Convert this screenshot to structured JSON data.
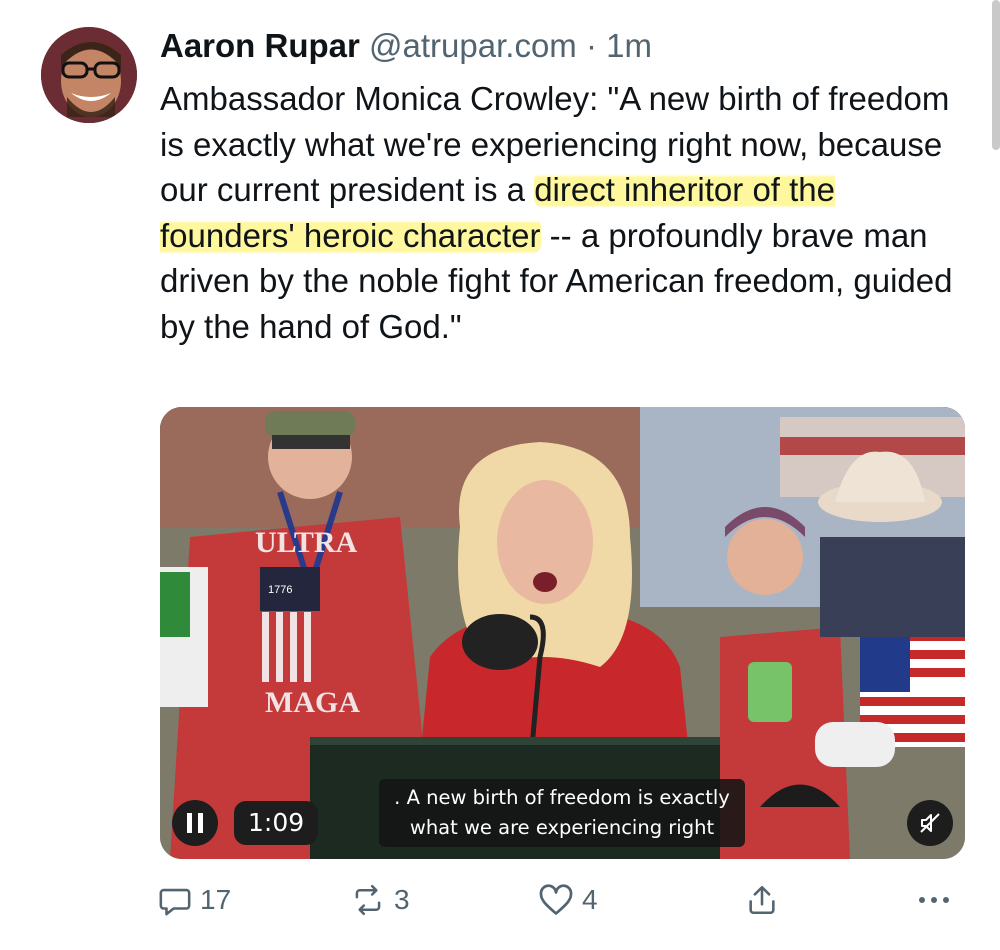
{
  "post": {
    "author": {
      "name": "Aaron Rupar",
      "handle": "@atrupar.com",
      "separator": "·",
      "time": "1m"
    },
    "text": {
      "part1": "Ambassador Monica Crowley: \"A new birth of freedom is exactly what we're experiencing right now, because our current president is a ",
      "highlight": "direct inheritor of the founders' heroic character",
      "part2": " -- a profoundly brave man driven by the noble fight for American freedom, guided by the hand of God.\""
    },
    "media": {
      "timestamp": "1:09",
      "caption_line1": ". A new birth of freedom is exactly",
      "caption_line2": "what we are experiencing right",
      "shirt_text_top": "ULTRA",
      "shirt_text_bottom": "MAGA",
      "shirt_year": "1776"
    },
    "actions": {
      "replies": "17",
      "reposts": "3",
      "likes": "4"
    }
  },
  "colors": {
    "text": "#0f1419",
    "secondary": "#536471",
    "highlight": "#fff68c"
  }
}
